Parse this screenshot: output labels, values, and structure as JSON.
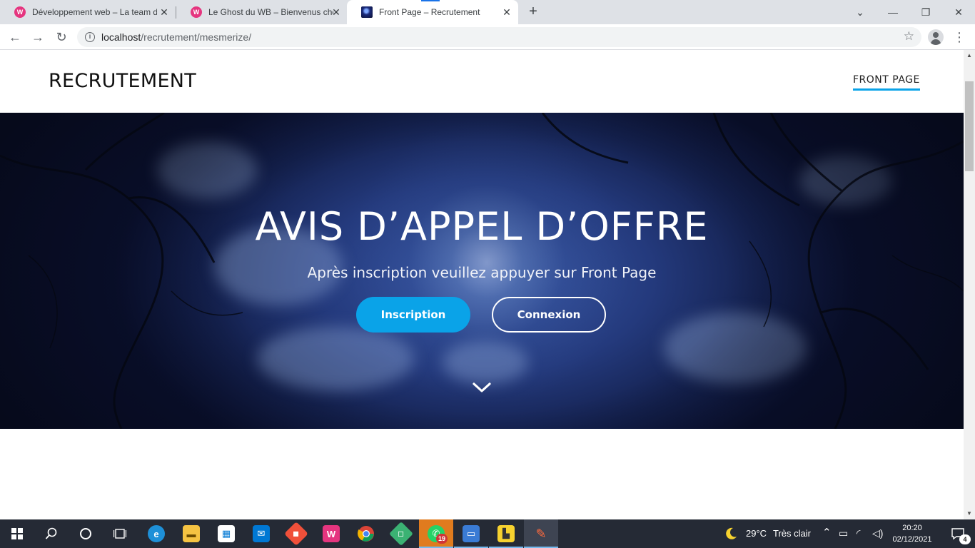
{
  "browser": {
    "tabs": [
      {
        "title": "Développement web – La team de",
        "icon": "wamp-icon"
      },
      {
        "title": "Le Ghost du WB – Bienvenus chez",
        "icon": "wamp-icon"
      },
      {
        "title": "Front Page – Recrutement",
        "icon": "site-icon",
        "active": true
      }
    ],
    "new_tab_label": "+",
    "address": {
      "host": "localhost",
      "path": "/recrutement/mesmerize/"
    }
  },
  "site": {
    "title": "RECRUTEMENT",
    "nav": [
      {
        "label": "FRONT PAGE",
        "active": true
      }
    ]
  },
  "hero": {
    "title": "AVIS D’APPEL D’OFFRE",
    "subtitle": "Après inscription veuillez appuyer sur Front Page",
    "primary_button": "Inscription",
    "secondary_button": "Connexion"
  },
  "taskbar": {
    "apps": [
      {
        "name": "edge-icon",
        "color": "#1e90d8"
      },
      {
        "name": "file-explorer-icon",
        "color": "#f5c342"
      },
      {
        "name": "store-icon",
        "color": "#ffffff"
      },
      {
        "name": "mail-icon",
        "color": "#0078d4"
      },
      {
        "name": "git-icon",
        "color": "#f0503a"
      },
      {
        "name": "wamp-icon",
        "color": "#e5357f"
      },
      {
        "name": "chrome-icon",
        "color": "#db4437"
      },
      {
        "name": "app-green-icon",
        "color": "#3bb273"
      },
      {
        "name": "whatsapp-icon",
        "color": "#25d366",
        "badge": "19"
      },
      {
        "name": "remote-desktop-icon",
        "color": "#3a7bd5"
      },
      {
        "name": "sticky-notes-icon",
        "color": "#f7d22f"
      },
      {
        "name": "paint-icon",
        "color": "#ff6a3d"
      }
    ],
    "weather": {
      "temp": "29°C",
      "label": "Très clair"
    },
    "clock": {
      "time": "20:20",
      "date": "02/12/2021"
    },
    "notifications": "4"
  },
  "colors": {
    "accent": "#0aa3e8",
    "taskbar": "#252a35",
    "tabbar": "#dee1e6"
  }
}
